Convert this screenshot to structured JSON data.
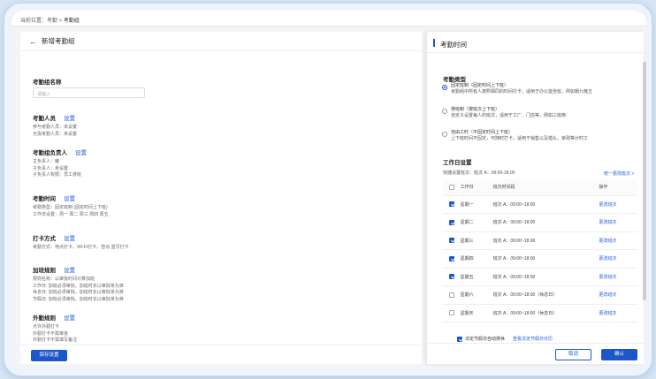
{
  "breadcrumb": {
    "prefix": "当前位置：",
    "item1": "考勤",
    "sep": ">",
    "current": "考勤组"
  },
  "left": {
    "title": "新增考勤组",
    "name_label": "考勤组名称",
    "name_placeholder": "请输入",
    "members": {
      "title": "考勤人员",
      "link": "设置",
      "lines": [
        "参与考勤人员：未设置",
        "无需考勤人员：未设置"
      ]
    },
    "owner": {
      "title": "考勤组负责人",
      "link": "设置",
      "lines": [
        "主负责人：曦",
        "子负责人：未设置",
        "子负责人权限：员工排班"
      ]
    },
    "time": {
      "title": "考勤时间",
      "link": "设置",
      "lines": [
        "考勤类型：固定班制 (固定时间上下班)",
        "工作日设置：周一 周二 周三 周四 周五"
      ]
    },
    "punch": {
      "title": "打卡方式",
      "link": "设置",
      "lines": [
        "考勤方式：地点打卡、WI-FI打卡，智点 蓝牙打卡"
      ]
    },
    "overtime": {
      "title": "加班规则",
      "link": "设置",
      "lines": [
        "规则名称：以审批时间计算加班",
        "工作日: 加班必须审批，加班时长以审批单为准",
        "休息日: 加班必须审批，加班时长以审批单为准",
        "节假日: 加班必须审批，加班时长以审批单为准"
      ]
    },
    "outside": {
      "title": "外勤规则",
      "link": "设置",
      "lines": [
        "允许外勤打卡",
        "外勤打卡不需审批",
        "外勤打卡不需填写备注"
      ]
    },
    "save": "保存设置"
  },
  "right": {
    "title": "考勤时间",
    "type_label": "考勤类型",
    "options": [
      {
        "name": "固定班制（固定时间上下班）",
        "desc": "考勤组中所有人按照相同的时间打卡，适用于办公室坐班，例如朝九晚五",
        "selected": true
      },
      {
        "name": "排班制（按班次上下班）",
        "desc": "自定义设置每人的班次，适用于工厂、门店等，例如三班倒",
        "selected": false
      },
      {
        "name": "自由工时（不固定时间上下班）",
        "desc": "上下班时间不固定，可随时打卡，适用于销售以及猎头，家政等计时工",
        "selected": false
      }
    ],
    "workday_label": "工作日设置",
    "quick": "快捷设置班次：班次 A：09:00-18:00",
    "unify": "统一更改班次 >",
    "headers": {
      "day": "工作日",
      "shift": "班次时间段",
      "action": "操作"
    },
    "rows": [
      {
        "day": "星期一",
        "shift": "班次 A：09:00~18:00",
        "action": "更改班次",
        "checked": true
      },
      {
        "day": "星期二",
        "shift": "班次 A：09:00~18:00",
        "action": "更改班次",
        "checked": true
      },
      {
        "day": "星期三",
        "shift": "班次 A：09:00~18:00",
        "action": "更改班次",
        "checked": true
      },
      {
        "day": "星期四",
        "shift": "班次 A：09:00~18:00",
        "action": "更改班次",
        "checked": true
      },
      {
        "day": "星期五",
        "shift": "班次 A：09:00~18:00",
        "action": "更改班次",
        "checked": true
      },
      {
        "day": "星期六",
        "shift": "班次 A：09:00~18:00（休息日）",
        "action": "更改班次",
        "checked": false
      },
      {
        "day": "星期天",
        "shift": "班次 A：09:00~18:00（休息日）",
        "action": "更改班次",
        "checked": false
      }
    ],
    "holiday": "法定节假日自动排休",
    "holiday_link": "查看法定节假日日历",
    "cancel": "取消",
    "ok": "确认"
  }
}
